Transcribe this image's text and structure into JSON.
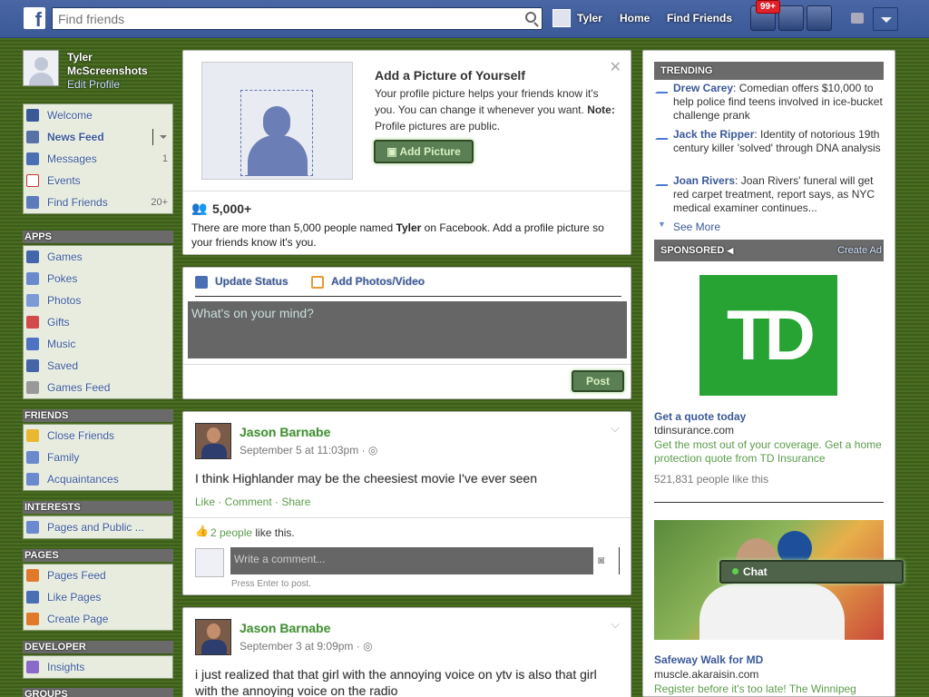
{
  "topbar": {
    "search_placeholder": "Find friends",
    "user_name": "Tyler",
    "home": "Home",
    "find_friends": "Find Friends",
    "notif_badge": "99+"
  },
  "profile": {
    "name_line1": "Tyler",
    "name_line2": "McScreenshots",
    "edit": "Edit Profile"
  },
  "sidebar": {
    "favorites": [
      {
        "label": "Welcome",
        "count": ""
      },
      {
        "label": "News Feed",
        "count": ""
      },
      {
        "label": "Messages",
        "count": "1"
      },
      {
        "label": "Events",
        "count": ""
      },
      {
        "label": "Find Friends",
        "count": "20+"
      }
    ],
    "apps_title": "APPS",
    "apps": [
      "Games",
      "Pokes",
      "Photos",
      "Gifts",
      "Music",
      "Saved",
      "Games Feed"
    ],
    "friends_title": "FRIENDS",
    "friends": [
      "Close Friends",
      "Family",
      "Acquaintances"
    ],
    "interests_title": "INTERESTS",
    "interests": [
      "Pages and Public ..."
    ],
    "pages_title": "PAGES",
    "pages": [
      "Pages Feed",
      "Like Pages",
      "Create Page"
    ],
    "developer_title": "DEVELOPER",
    "developer": [
      "Insights"
    ],
    "groups_title": "GROUPS"
  },
  "profile_prompt": {
    "title": "Add a Picture of Yourself",
    "text": "Your profile picture helps your friends know it's you. You can change it whenever you want.",
    "note_label": "Note:",
    "note_text": "Profile pictures are public.",
    "button": "Add Picture",
    "count": "5,000+",
    "info_pre": "There are more than 5,000 people named",
    "info_name": "Tyler",
    "info_post": "on Facebook. Add a profile picture so your friends know it's you."
  },
  "composer": {
    "update_status": "Update Status",
    "add_photos": "Add Photos/Video",
    "placeholder": "What's on your mind?",
    "post_button": "Post"
  },
  "posts": [
    {
      "author": "Jason Barnabe",
      "date": "September 5 at 11:03pm",
      "text": "I think Highlander may be the cheesiest movie I've ever seen",
      "actions": "Like · Comment · Share",
      "likes_link": "2 people",
      "likes_suffix": "like this.",
      "comment_placeholder": "Write a comment...",
      "comment_hint": "Press Enter to post."
    },
    {
      "author": "Jason Barnabe",
      "date": "September 3 at 9:09pm",
      "text": "i just realized that that girl with the annoying voice on ytv is also that girl with the annoying voice on the radio"
    }
  ],
  "trending": {
    "title": "TRENDING",
    "items": [
      {
        "name": "Drew Carey",
        "text": "Comedian offers $10,000 to help police find teens involved in ice-bucket challenge prank"
      },
      {
        "name": "Jack the Ripper",
        "text": "Identity of notorious 19th century killer 'solved' through DNA analysis"
      },
      {
        "name": "Joan Rivers",
        "text": "Joan Rivers' funeral will get red carpet treatment, report says, as NYC medical examiner continues..."
      }
    ],
    "see_more": "See More"
  },
  "sponsored": {
    "title": "SPONSORED",
    "create_ad": "Create Ad",
    "ad1": {
      "logo": "TD",
      "title": "Get a quote today",
      "domain": "tdinsurance.com",
      "text": "Get the most out of your coverage. Get a home protection quote from TD Insurance",
      "likes": "521,831 people like this"
    },
    "ad2": {
      "title": "Safeway Walk for MD",
      "domain": "muscle.akaraisin.com",
      "text": "Register before it's too late! The Winnipeg"
    }
  },
  "chat": {
    "label": "Chat"
  }
}
